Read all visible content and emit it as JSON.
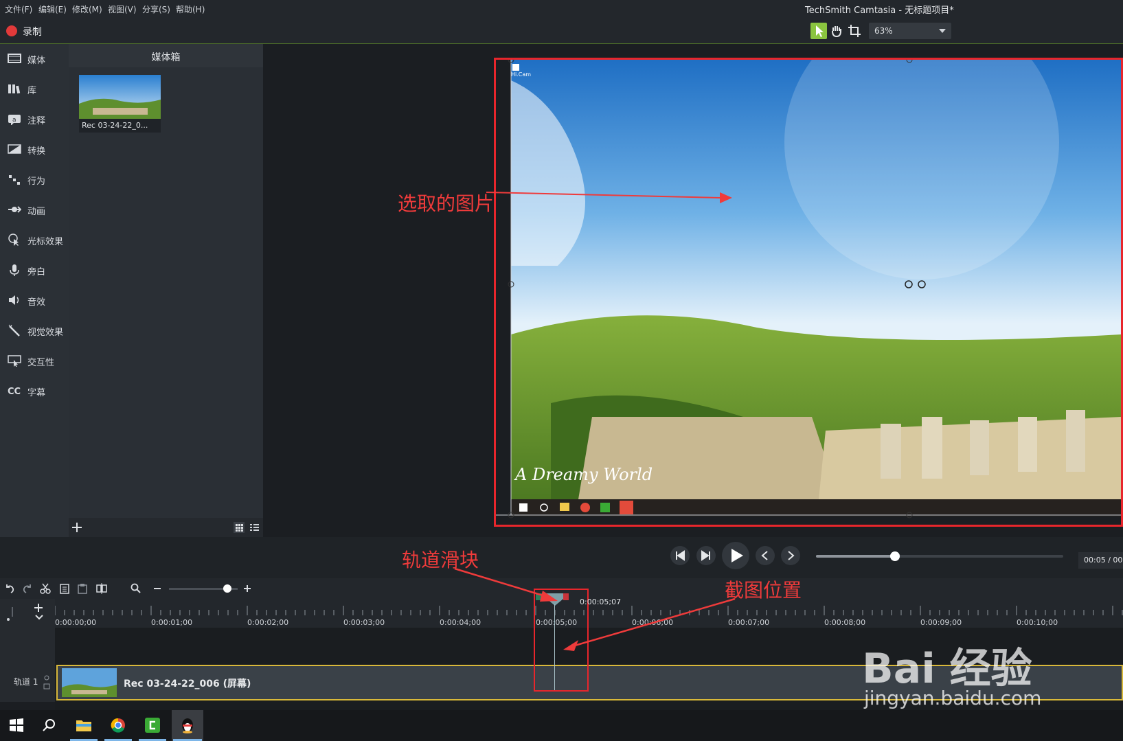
{
  "menu": {
    "file": "文件(F)",
    "edit": "编辑(E)",
    "modify": "修改(M)",
    "view": "视图(V)",
    "share": "分享(S)",
    "help": "帮助(H)"
  },
  "app_title": "TechSmith Camtasia - 无标题项目*",
  "toolbar": {
    "record_label": "录制",
    "zoom_value": "63%"
  },
  "sidebar": {
    "items": [
      {
        "label": "媒体",
        "icon": "media-icon"
      },
      {
        "label": "库",
        "icon": "library-icon"
      },
      {
        "label": "注释",
        "icon": "annotation-icon"
      },
      {
        "label": "转换",
        "icon": "transition-icon"
      },
      {
        "label": "行为",
        "icon": "behavior-icon"
      },
      {
        "label": "动画",
        "icon": "animation-icon"
      },
      {
        "label": "光标效果",
        "icon": "cursor-effect-icon"
      },
      {
        "label": "旁白",
        "icon": "microphone-icon"
      },
      {
        "label": "音效",
        "icon": "speaker-icon"
      },
      {
        "label": "视觉效果",
        "icon": "wand-icon"
      },
      {
        "label": "交互性",
        "icon": "interactive-icon"
      },
      {
        "label": "字幕",
        "icon": "cc-icon"
      }
    ]
  },
  "mediabin": {
    "title": "媒体箱",
    "item_caption": "Rec 03-24-22_0..."
  },
  "canvas": {
    "desktop_icon_label": "Hi.Cam",
    "wallpaper_text": "A Dreamy World",
    "annotation_selected": "选取的图片"
  },
  "transport": {
    "time_readout": "00:05 / 00:",
    "progress": 0.32
  },
  "timeline": {
    "playhead_time": "0:00:05;07",
    "ticks": [
      "0:00:00;00",
      "0:00:01;00",
      "0:00:02;00",
      "0:00:03;00",
      "0:00:04;00",
      "0:00:05;00",
      "0:00:06;00",
      "0:00:07;00",
      "0:00:08;00",
      "0:00:09;00",
      "0:00:10;00"
    ],
    "track_label": "轨道 1",
    "clip_label": "Rec 03-24-22_006 (屏幕)",
    "annotation_slider": "轨道滑块",
    "annotation_position": "截图位置",
    "zoom_level": 0.85
  },
  "watermark": {
    "brand": "Bai 经验",
    "url": "jingyan.baidu.com"
  },
  "colors": {
    "accent_green": "#8bc53f",
    "annotation_red": "#e8262c",
    "record_red": "#e23a3a",
    "clip_border": "#d9b93a"
  }
}
